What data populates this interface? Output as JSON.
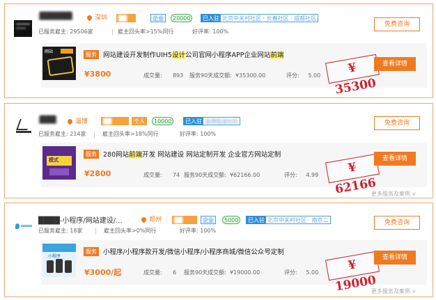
{
  "colors": {
    "accent": "#f07a20",
    "stamp_red": "#d02030",
    "settled_blue": "#2f8fd8",
    "green": "#3fb34f",
    "card_border": "#f0a66e"
  },
  "cards": [
    {
      "name": "██████",
      "location": "深圳",
      "level": "██",
      "tags": [
        "企业",
        "20000"
      ],
      "settled": "已入驻",
      "address": "北京中关村社区 · 长春社区 · 成都社区",
      "served": "已服务雇主: 29506家",
      "repurchase": "雇主回头率>15%同行",
      "rating": "好评率: 100%",
      "consult_label": "免费咨询",
      "service_tag": "服务",
      "title_a": "网站建设开发制作UIH5",
      "title_hl1": "设计",
      "title_b": "公司官网小程序APP企业网站",
      "title_hl2": "前端",
      "title_c": "",
      "price": "¥3800",
      "volume_label": "成交量:",
      "volume": "893",
      "amount_label": "服务90天成交额:",
      "amount": "¥35300.00",
      "score_label": "评分:",
      "score": "5.00",
      "stamp": "¥ 35300",
      "detail_label": "查看详情",
      "more": "",
      "thumb_text": "网站"
    },
    {
      "name": "███",
      "location": "淄博",
      "level": "██",
      "tags": [
        "个人",
        "10000"
      ],
      "settled": "已入驻",
      "address": "淄博临淄社区",
      "served": "已服务雇主: 214家",
      "repurchase": "雇主回头率>18%同行",
      "rating": "好评率: 100%",
      "consult_label": "免费咨询",
      "service_tag": "服务",
      "title_a": "280网站",
      "title_hl1": "前端",
      "title_b": "开发 网站建设 网站定制开发 企业官方网站定制",
      "title_hl2": "",
      "title_c": "",
      "price": "¥2800",
      "volume_label": "成交量:",
      "volume": "74",
      "amount_label": "服务90天成交额:",
      "amount": "¥62166.00",
      "score_label": "评分:",
      "score": "4.99",
      "stamp": "¥ 62166",
      "detail_label": "查看详情",
      "more": "更多服务及案例 ∨",
      "thumb_text": "模式"
    },
    {
      "name": "████-小程序/网站建设/...",
      "location": "郑州",
      "level": "██",
      "tags": [
        "企业",
        "5000"
      ],
      "settled": "已入驻",
      "address": "北京中关村社区 · 南京二",
      "served": "已服务雇主: 18家",
      "repurchase": "雇主回头率>0%同行",
      "rating": "好评率: 100%",
      "consult_label": "免费咨询",
      "service_tag": "服务",
      "title_a": "小程序/小程序款开发/微信小程序/小程序商城/微信公众号定制",
      "title_hl1": "",
      "title_b": "",
      "title_hl2": "",
      "title_c": "",
      "price": "¥3000/起",
      "volume_label": "成交量:",
      "volume": "6",
      "amount_label": "服务90天成交额:",
      "amount": "¥19000.00",
      "score_label": "评分:",
      "score": "5.00",
      "stamp": "¥ 19000",
      "detail_label": "查看详情",
      "more": "更多服务及案例 ∨",
      "thumb_text": "小程序"
    }
  ]
}
